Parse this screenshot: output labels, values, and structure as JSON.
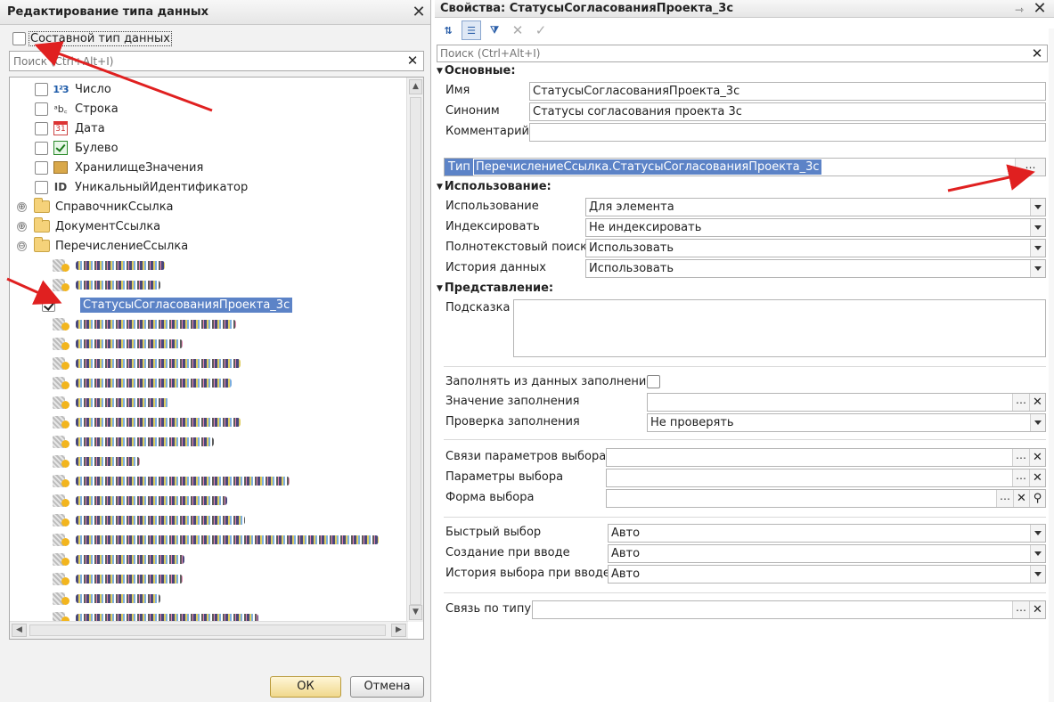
{
  "left_dialog": {
    "title": "Редактирование типа данных",
    "composite_label": "Составной тип данных",
    "search_placeholder": "Поиск (Ctrl+Alt+I)",
    "types": [
      {
        "icon": "number-icon",
        "glyph": "1²3",
        "label": "Число"
      },
      {
        "icon": "string-icon",
        "glyph": "ᵃbc",
        "label": "Строка"
      },
      {
        "icon": "date-icon",
        "glyph": "31",
        "label": "Дата"
      },
      {
        "icon": "boolean-icon",
        "glyph": "",
        "label": "Булево"
      },
      {
        "icon": "value-storage-icon",
        "glyph": "",
        "label": "ХранилищеЗначения"
      },
      {
        "icon": "uuid-icon",
        "glyph": "ID",
        "label": "УникальныйИдентификатор"
      }
    ],
    "groups": [
      {
        "label": "СправочникСсылка",
        "expander": "⊕"
      },
      {
        "label": "ДокументСсылка",
        "expander": "⊕"
      },
      {
        "label": "ПеречислениеСсылка",
        "expander": "⊖"
      }
    ],
    "selected_enum": "СтатусыСогласованияПроекта_3с",
    "ok_label": "ОК",
    "cancel_label": "Отмена"
  },
  "properties_panel": {
    "title": "Свойства: СтатусыСогласованияПроекта_3с",
    "search_placeholder": "Поиск (Ctrl+Alt+I)",
    "sections": {
      "main": "Основные:",
      "usage": "Использование:",
      "presentation": "Представление:"
    },
    "fields": {
      "name_label": "Имя",
      "name_value": "СтатусыСогласованияПроекта_3с",
      "synonym_label": "Синоним",
      "synonym_value": "Статусы согласования проекта 3с",
      "comment_label": "Комментарий",
      "comment_value": "",
      "type_label": "Тип",
      "type_value": "ПеречислениеСсылка.СтатусыСогласованияПроекта_3с",
      "use_label": "Использование",
      "use_value": "Для элемента",
      "index_label": "Индексировать",
      "index_value": "Не индексировать",
      "fulltext_label": "Полнотекстовый поиск",
      "fulltext_value": "Использовать",
      "history_label": "История данных",
      "history_value": "Использовать",
      "hint_label": "Подсказка",
      "fill_from_label": "Заполнять из данных заполнения",
      "fill_value_label": "Значение заполнения",
      "fill_check_label": "Проверка заполнения",
      "fill_check_value": "Не проверять",
      "choice_links_label": "Связи параметров выбора",
      "choice_params_label": "Параметры выбора",
      "choice_form_label": "Форма выбора",
      "quick_choice_label": "Быстрый выбор",
      "quick_choice_value": "Авто",
      "create_on_input_label": "Создание при вводе",
      "create_on_input_value": "Авто",
      "choice_history_label": "История выбора при вводе",
      "choice_history_value": "Авто",
      "type_link_label": "Связь по типу"
    }
  },
  "colors": {
    "selection": "#5c83c7",
    "arrow": "#e02020"
  }
}
